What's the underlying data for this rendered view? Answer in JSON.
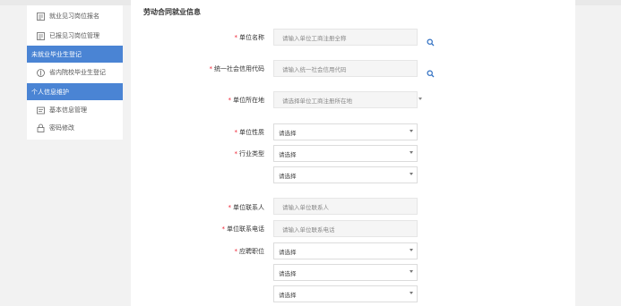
{
  "sidebar": {
    "items": [
      {
        "label": "就业见习岗位报名",
        "icon": "form-icon"
      },
      {
        "label": "已报见习岗位管理",
        "icon": "form-icon"
      }
    ],
    "section_unemployed": "未就业毕业生登记",
    "sub_items": [
      {
        "label": "省内院校毕业生登记",
        "icon": "location-icon"
      }
    ],
    "section_personal": "个人信息维护",
    "personal_items": [
      {
        "label": "基本信息管理",
        "icon": "id-card-icon"
      },
      {
        "label": "密码修改",
        "icon": "lock-icon"
      }
    ]
  },
  "form": {
    "section_title": "劳动合同就业信息",
    "unit_name": {
      "label": "单位名称",
      "placeholder": "请输入单位工商注册全称"
    },
    "credit_code": {
      "label": "统一社会信用代码",
      "placeholder": "请输入统一社会信用代码"
    },
    "unit_region": {
      "label": "单位所在地",
      "placeholder": "请选择单位工商注册所在地"
    },
    "unit_nature": {
      "label": "单位性质",
      "value": "请选择"
    },
    "industry": {
      "label": "行业类型",
      "value1": "请选择",
      "value2": "请选择"
    },
    "contact": {
      "label": "单位联系人",
      "placeholder": "请输入单位联系人"
    },
    "phone": {
      "label": "单位联系电话",
      "placeholder": "请输入单位联系电话"
    },
    "position": {
      "label": "应聘职位",
      "value1": "请选择",
      "value2": "请选择",
      "value3": "请选择"
    },
    "required_mark": "*"
  },
  "colors": {
    "accent": "#4a84d4",
    "required": "#e23333",
    "search_icon": "#2f6fc2"
  }
}
